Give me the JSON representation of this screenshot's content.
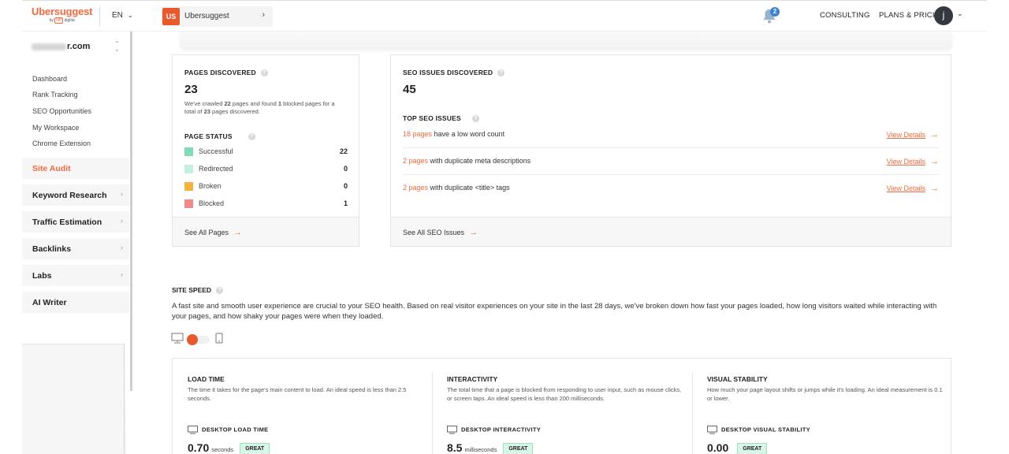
{
  "header": {
    "logo": "Ubersuggest",
    "logo_by": "by",
    "logo_np": "NP",
    "logo_digital": "digital",
    "lang": "EN",
    "project_badge": "US",
    "project_name": "Ubersuggest",
    "notifications": "2",
    "consulting": "CONSULTING",
    "plans": "PLANS & PRICING",
    "avatar": "j"
  },
  "sidebar": {
    "domain_visible": "r.com",
    "sub_items": [
      "Dashboard",
      "Rank Tracking",
      "SEO Opportunities",
      "My Workspace",
      "Chrome Extension"
    ],
    "items": [
      {
        "label": "Site Audit",
        "active": true
      },
      {
        "label": "Keyword Research"
      },
      {
        "label": "Traffic Estimation"
      },
      {
        "label": "Backlinks"
      },
      {
        "label": "Labs"
      },
      {
        "label": "AI Writer"
      }
    ]
  },
  "pages": {
    "title": "PAGES DISCOVERED",
    "count": "23",
    "note_1": "We've crawled ",
    "note_crawled": "22",
    "note_2": " pages and found ",
    "note_blocked": "1",
    "note_3": " blocked pages for a total of ",
    "note_total": "23",
    "note_4": " pages discovered.",
    "status_title": "PAGE STATUS",
    "status": [
      {
        "label": "Successful",
        "value": "22",
        "color": "#7fdcb5"
      },
      {
        "label": "Redirected",
        "value": "0",
        "color": "#c4f0dd"
      },
      {
        "label": "Broken",
        "value": "0",
        "color": "#f3b33d"
      },
      {
        "label": "Blocked",
        "value": "1",
        "color": "#f08a8a"
      }
    ],
    "footer": "See All Pages"
  },
  "seo": {
    "title": "SEO ISSUES DISCOVERED",
    "count": "45",
    "top_title": "TOP SEO ISSUES",
    "issues": [
      {
        "count": "18 pages",
        "text": " have a low word count",
        "link": "View Details"
      },
      {
        "count": "2 pages",
        "text": " with duplicate meta descriptions",
        "link": "View Details"
      },
      {
        "count": "2 pages",
        "text": " with duplicate <title> tags",
        "link": "View Details"
      }
    ],
    "footer": "See All SEO Issues"
  },
  "speed": {
    "title": "SITE SPEED",
    "desc": "A fast site and smooth user experience are crucial to your SEO health. Based on real visitor experiences on your site in the last 28 days, we've broken down how fast your pages loaded, how long visitors waited while interacting with your pages, and how shaky your pages were when they loaded.",
    "cols": [
      {
        "h": "LOAD TIME",
        "d": "The time it takes for the page's main content to load. An ideal speed is less than 2.5 seconds.",
        "mon": "DESKTOP LOAD TIME",
        "val": "0.70",
        "unit": "seconds",
        "badge": "GREAT"
      },
      {
        "h": "INTERACTIVITY",
        "d": "The total time that a page is blocked from responding to user input, such as mouse clicks, or screen taps. An ideal speed is less than 200 milliseconds.",
        "mon": "DESKTOP INTERACTIVITY",
        "val": "8.5",
        "unit": "milliseconds",
        "badge": "GREAT"
      },
      {
        "h": "VISUAL STABILITY",
        "d": "How much your page layout shifts or jumps while it's loading. An ideal measurement is 0.1 or lower.",
        "mon": "DESKTOP VISUAL STABILITY",
        "val": "0.00",
        "unit": "",
        "badge": "GREAT"
      }
    ]
  }
}
